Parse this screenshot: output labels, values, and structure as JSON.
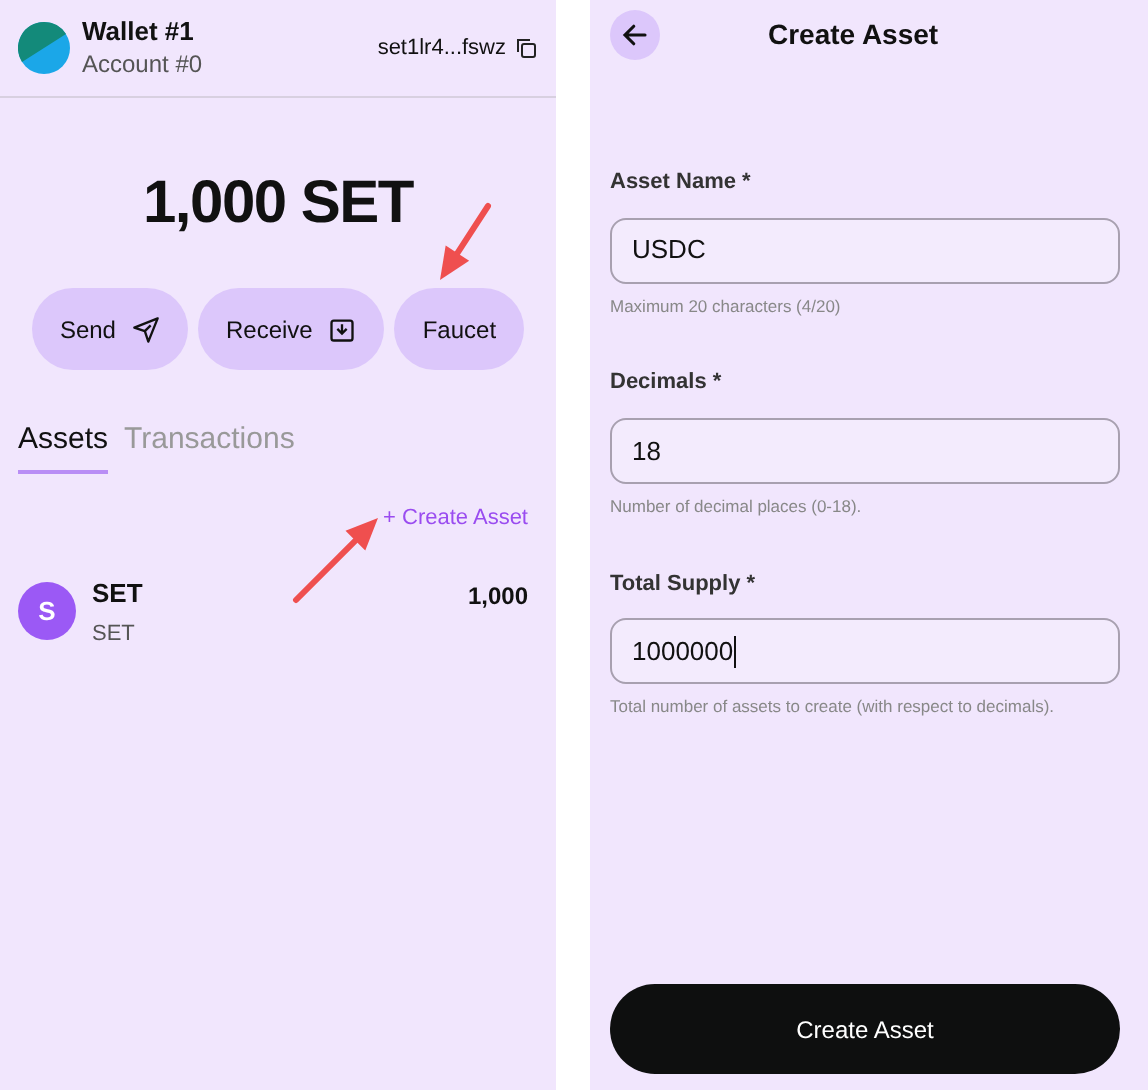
{
  "wallet": {
    "name": "Wallet #1",
    "account": "Account #0",
    "address": "set1lr4...fswz",
    "balance": "1,000 SET",
    "actions": [
      {
        "label": "Send",
        "kind": "send"
      },
      {
        "label": "Receive",
        "kind": "receive"
      },
      {
        "label": "Faucet",
        "kind": "plain"
      }
    ],
    "tabs": [
      {
        "label": "Assets",
        "selected": true
      },
      {
        "label": "Transactions",
        "selected": false
      }
    ],
    "create_link": "+ Create Asset",
    "assets": [
      {
        "initial": "S",
        "name": "SET",
        "symbol": "SET",
        "amount": "1,000"
      }
    ]
  },
  "create_asset": {
    "title": "Create Asset",
    "fields": [
      {
        "label": "Asset Name *",
        "value": "USDC",
        "help": "Maximum 20 characters (4/20)"
      },
      {
        "label": "Decimals *",
        "value": "18",
        "help": "Number of decimal places (0-18)."
      },
      {
        "label": "Total Supply *",
        "value": "1000000",
        "help": "Total number of assets to create (with respect to decimals).",
        "focused": true
      }
    ],
    "submit": "Create Asset"
  }
}
